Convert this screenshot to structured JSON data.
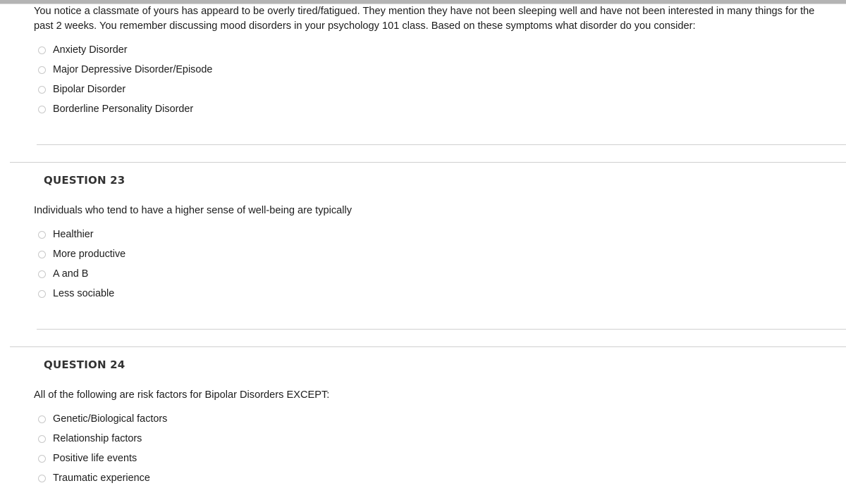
{
  "page": {
    "top_bar": "",
    "accent_rule_color": "#d0d0d0",
    "text_color": "#1c1c1c",
    "header_color": "#333333"
  },
  "questions": [
    {
      "header": "",
      "prompt": "You notice a classmate of yours has appeard to be overly tired/fatigued. They mention they have not been sleeping well and have not been interested in many things for the past 2 weeks. You remember discussing mood disorders in your psychology 101 class. Based on these symptoms what disorder do you consider:",
      "options": [
        {
          "label": "Anxiety Disorder",
          "selected": false
        },
        {
          "label": "Major Depressive Disorder/Episode",
          "selected": false
        },
        {
          "label": "Bipolar Disorder",
          "selected": false
        },
        {
          "label": "Borderline Personality Disorder",
          "selected": false
        }
      ]
    },
    {
      "header": "QUESTION 23",
      "prompt": "Individuals who tend to have a higher sense of well-being are typically",
      "options": [
        {
          "label": "Healthier",
          "selected": false
        },
        {
          "label": "More productive",
          "selected": false
        },
        {
          "label": "A and B",
          "selected": false
        },
        {
          "label": "Less sociable",
          "selected": false
        }
      ]
    },
    {
      "header": "QUESTION 24",
      "prompt": "All of the following are risk factors for Bipolar Disorders EXCEPT:",
      "options": [
        {
          "label": "Genetic/Biological factors",
          "selected": false
        },
        {
          "label": "Relationship factors",
          "selected": false
        },
        {
          "label": "Positive life events",
          "selected": false
        },
        {
          "label": "Traumatic experience",
          "selected": false
        }
      ]
    }
  ]
}
